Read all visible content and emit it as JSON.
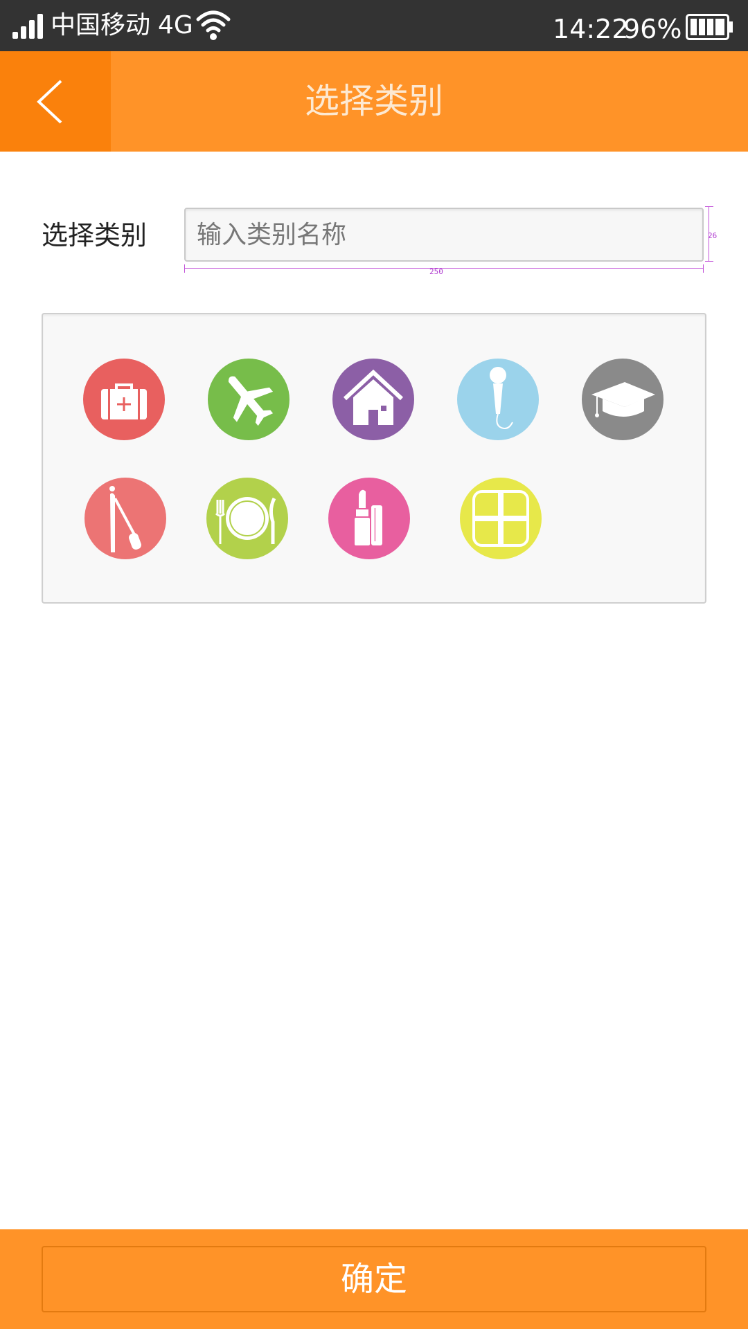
{
  "status_bar": {
    "carrier": "中国移动",
    "network": "4G",
    "time": "14:22",
    "battery": "96%",
    "icons": [
      "signal-icon",
      "wifi-icon",
      "battery-icon"
    ]
  },
  "header": {
    "title": "选择类别",
    "back_icon": "chevron-left-icon"
  },
  "form": {
    "label": "选择类别",
    "input_placeholder": "输入类别名称",
    "input_value": "",
    "annotation_width": "250",
    "annotation_height": "26"
  },
  "categories": [
    {
      "icon": "first-aid-kit-icon",
      "color": "#e8605f"
    },
    {
      "icon": "airplane-icon",
      "color": "#77bd4a"
    },
    {
      "icon": "house-icon",
      "color": "#8c5fa6"
    },
    {
      "icon": "microphone-icon",
      "color": "#9bd3eb"
    },
    {
      "icon": "graduation-cap-icon",
      "color": "#8a8a8a"
    },
    {
      "icon": "walking-stick-icon",
      "color": "#ec7474"
    },
    {
      "icon": "plate-fork-knife-icon",
      "color": "#b2d14b"
    },
    {
      "icon": "lipstick-icon",
      "color": "#e85f9f"
    },
    {
      "icon": "grid-icon",
      "color": "#e7e84a"
    }
  ],
  "footer": {
    "confirm_label": "确定"
  },
  "colors": {
    "status_bar": "#333333",
    "header": "#ff9328",
    "back_button": "#fa810c",
    "footer": "#ff9328"
  }
}
